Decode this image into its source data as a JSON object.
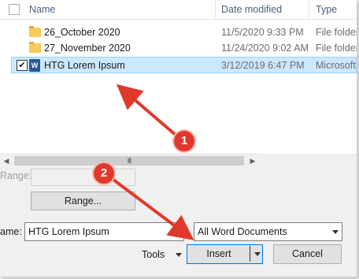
{
  "list": {
    "columns": {
      "name": "Name",
      "date_modified": "Date modified",
      "type": "Type"
    },
    "rows": [
      {
        "name": "26_October 2020",
        "date": "11/5/2020 9:33 PM",
        "type": "File folder",
        "icon": "folder-icon"
      },
      {
        "name": "27_November 2020",
        "date": "11/24/2020 9:02 AM",
        "type": "File folder",
        "icon": "folder-icon"
      },
      {
        "name": "HTG Lorem Ipsum",
        "date": "3/12/2019 6:47 PM",
        "type": "Microsoft",
        "icon": "word-document-icon",
        "checked": true,
        "selected": true
      }
    ],
    "scroll_grip": "III"
  },
  "range": {
    "label": "Range:",
    "button": "Range..."
  },
  "filename": {
    "label": "ame:",
    "value": "HTG Lorem Ipsum"
  },
  "filter": {
    "value": "All Word Documents"
  },
  "actions": {
    "tools": "Tools",
    "insert": "Insert",
    "cancel": "Cancel"
  },
  "annotations": [
    {
      "label": "1"
    },
    {
      "label": "2"
    }
  ],
  "colors": {
    "selection_bg": "#cce8ff",
    "arrow": "#e0392b",
    "folder": "#f5cb5a",
    "word": "#2b579a"
  }
}
